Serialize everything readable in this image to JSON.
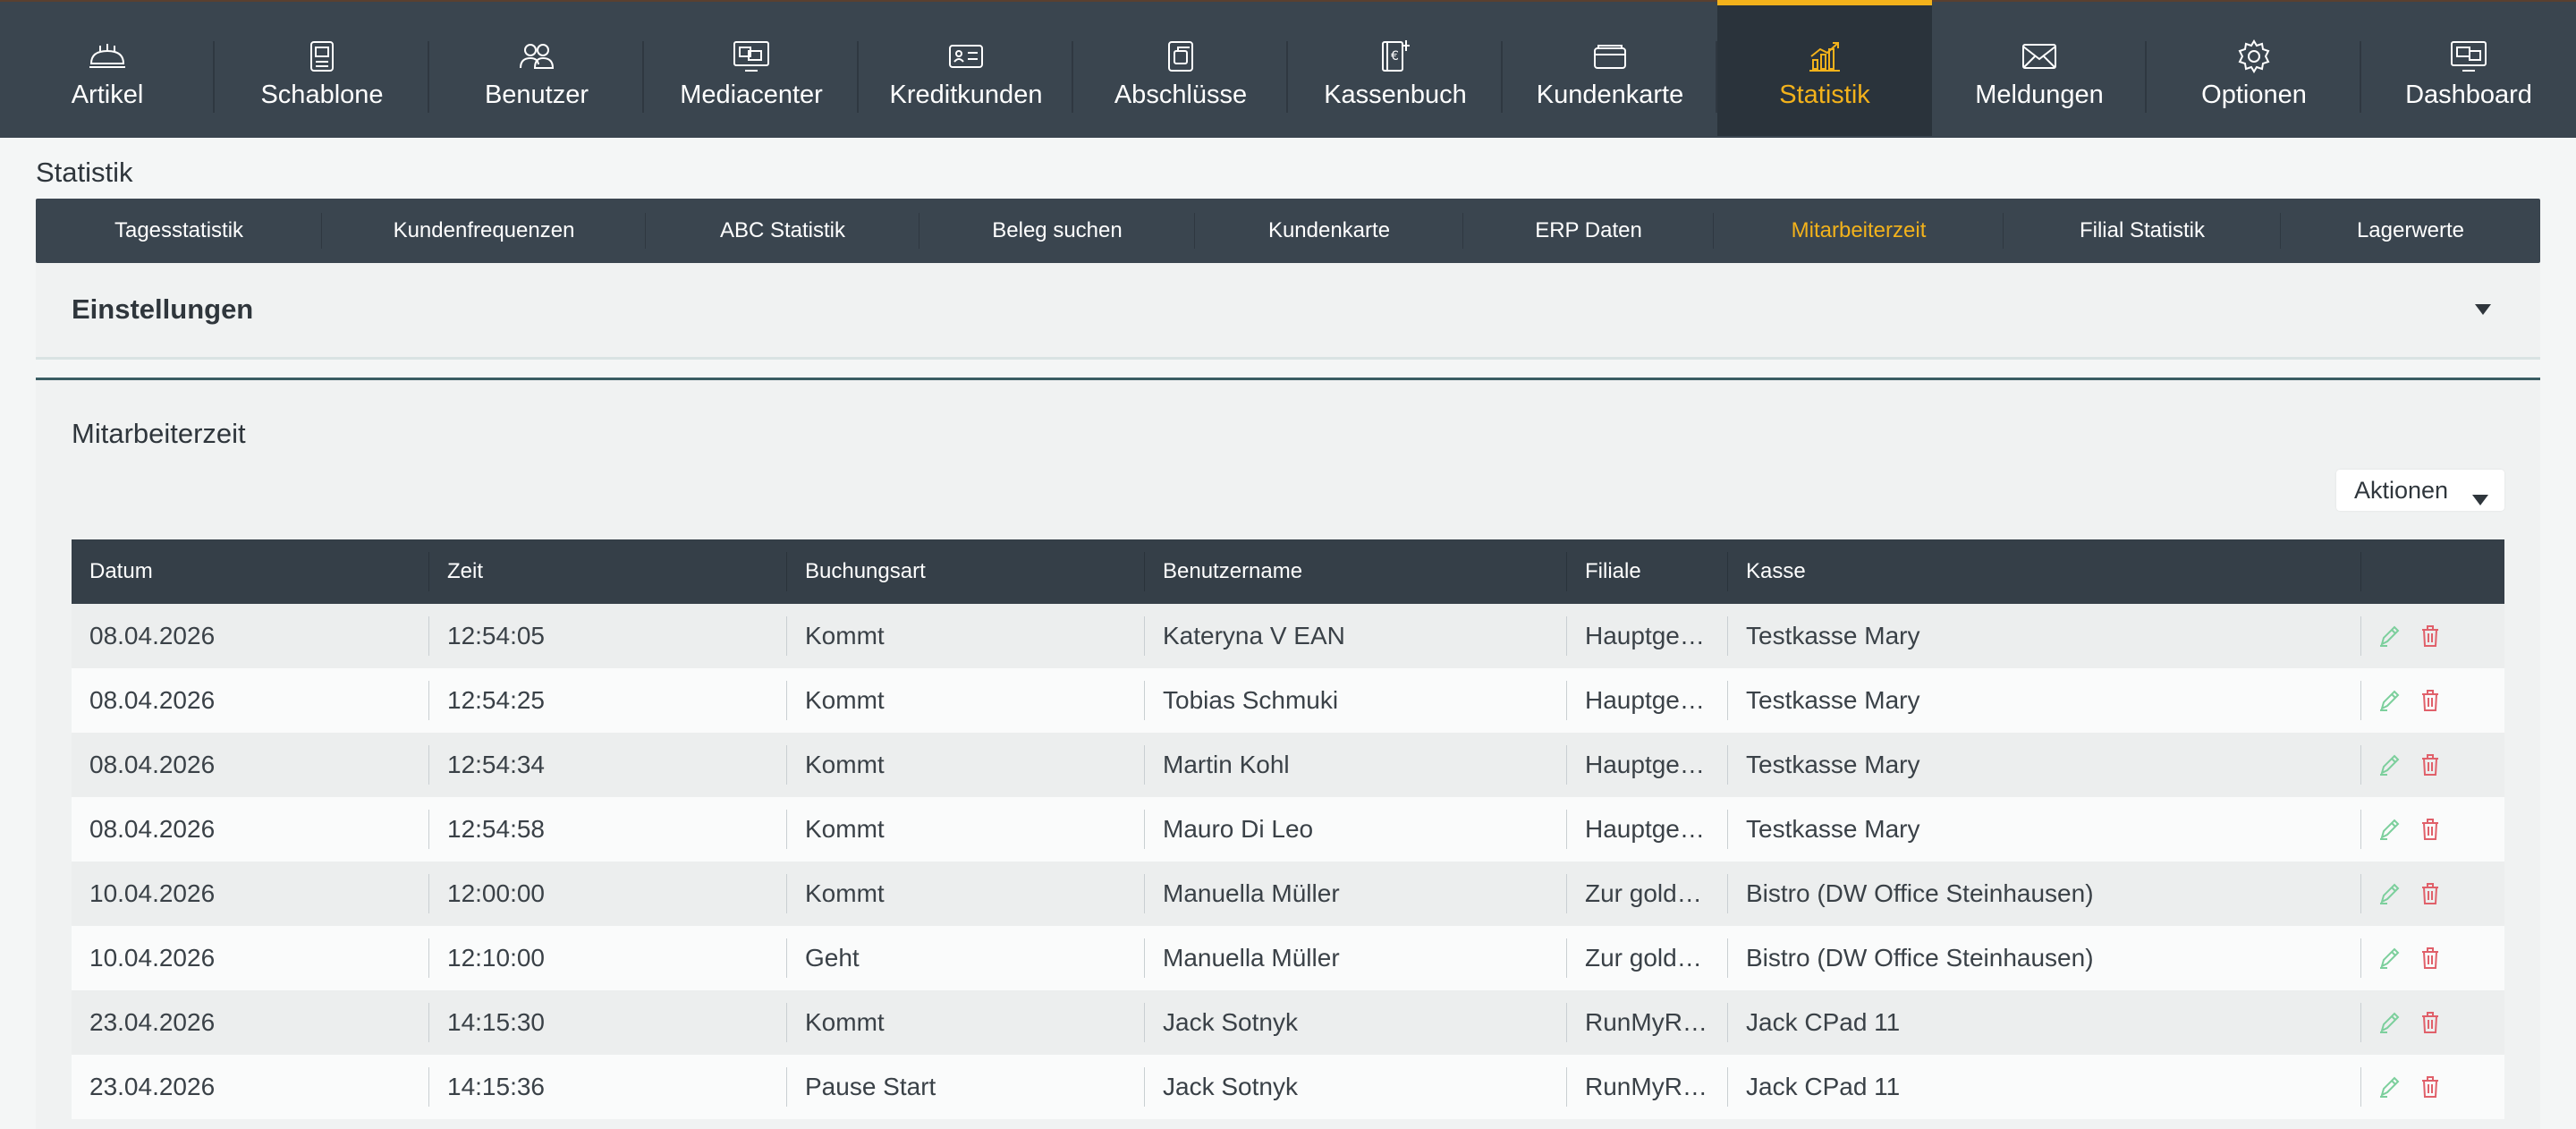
{
  "nav": {
    "items": [
      {
        "label": "Artikel",
        "icon": "bread-icon"
      },
      {
        "label": "Schablone",
        "icon": "document-icon"
      },
      {
        "label": "Benutzer",
        "icon": "users-icon"
      },
      {
        "label": "Mediacenter",
        "icon": "monitor-icon"
      },
      {
        "label": "Kreditkunden",
        "icon": "id-card-icon"
      },
      {
        "label": "Abschlüsse",
        "icon": "copy-icon"
      },
      {
        "label": "Kassenbuch",
        "icon": "book-icon"
      },
      {
        "label": "Kundenkarte",
        "icon": "card-icon"
      },
      {
        "label": "Statistik",
        "icon": "chart-icon",
        "active": true
      },
      {
        "label": "Meldungen",
        "icon": "envelope-icon"
      },
      {
        "label": "Optionen",
        "icon": "gear-icon"
      },
      {
        "label": "Dashboard",
        "icon": "dashboard-icon"
      }
    ]
  },
  "page_title": "Statistik",
  "subtabs": [
    {
      "label": "Tagesstatistik"
    },
    {
      "label": "Kundenfrequenzen"
    },
    {
      "label": "ABC Statistik"
    },
    {
      "label": "Beleg suchen"
    },
    {
      "label": "Kundenkarte"
    },
    {
      "label": "ERP Daten"
    },
    {
      "label": "Mitarbeiterzeit",
      "active": true
    },
    {
      "label": "Filial Statistik"
    },
    {
      "label": "Lagerwerte"
    }
  ],
  "settings": {
    "title": "Einstellungen"
  },
  "section": {
    "title": "Mitarbeiterzeit",
    "actions_label": "Aktionen"
  },
  "table": {
    "columns": [
      "Datum",
      "Zeit",
      "Buchungsart",
      "Benutzername",
      "Filiale",
      "Kasse",
      ""
    ],
    "rows": [
      [
        "08.04.2026",
        "12:54:05",
        "Kommt",
        "Kateryna V EAN",
        "Hauptges…",
        "Testkasse Mary"
      ],
      [
        "08.04.2026",
        "12:54:25",
        "Kommt",
        "Tobias Schmuki",
        "Hauptges…",
        "Testkasse Mary"
      ],
      [
        "08.04.2026",
        "12:54:34",
        "Kommt",
        "Martin Kohl",
        "Hauptges…",
        "Testkasse Mary"
      ],
      [
        "08.04.2026",
        "12:54:58",
        "Kommt",
        "Mauro Di Leo",
        "Hauptges…",
        "Testkasse Mary"
      ],
      [
        "10.04.2026",
        "12:00:00",
        "Kommt",
        "Manuella Müller",
        "Zur golde…",
        "Bistro (DW Office Steinhausen)"
      ],
      [
        "10.04.2026",
        "12:10:00",
        "Geht",
        "Manuella Müller",
        "Zur golde…",
        "Bistro (DW Office Steinhausen)"
      ],
      [
        "23.04.2026",
        "14:15:30",
        "Kommt",
        "Jack Sotnyk",
        "RunMyRe…",
        "Jack CPad 11"
      ],
      [
        "23.04.2026",
        "14:15:36",
        "Pause Start",
        "Jack Sotnyk",
        "RunMyRe…",
        "Jack CPad 11"
      ]
    ]
  },
  "colors": {
    "accent": "#f3b21b",
    "nav_bg": "#3a454f",
    "edit": "#7ccf9c",
    "delete": "#e0606a"
  }
}
